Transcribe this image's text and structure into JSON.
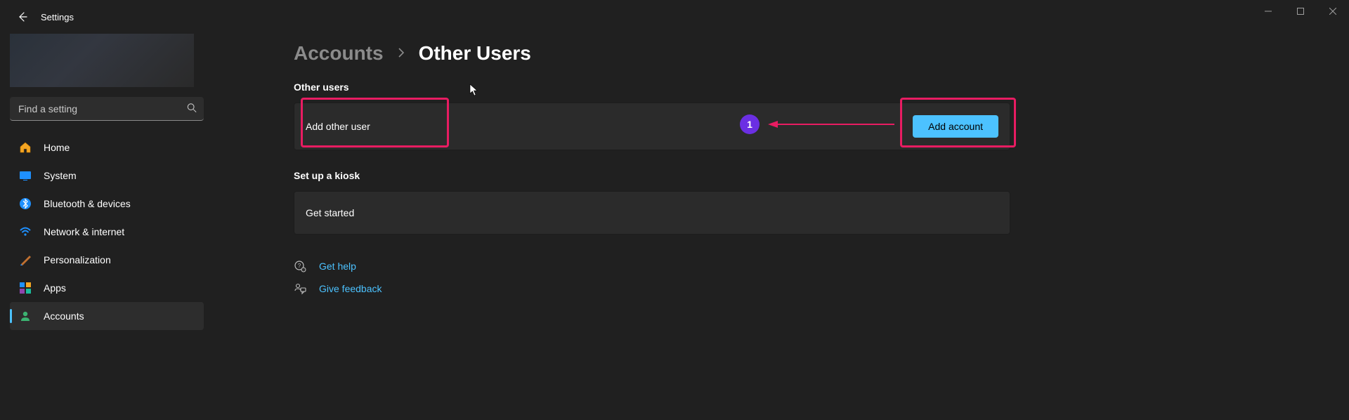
{
  "window": {
    "title": "Settings"
  },
  "search": {
    "placeholder": "Find a setting"
  },
  "sidebar": {
    "items": [
      {
        "label": "Home",
        "icon": "home",
        "active": false
      },
      {
        "label": "System",
        "icon": "display",
        "active": false
      },
      {
        "label": "Bluetooth & devices",
        "icon": "bluetooth",
        "active": false
      },
      {
        "label": "Network & internet",
        "icon": "wifi",
        "active": false
      },
      {
        "label": "Personalization",
        "icon": "brush",
        "active": false
      },
      {
        "label": "Apps",
        "icon": "apps",
        "active": false
      },
      {
        "label": "Accounts",
        "icon": "person",
        "active": true
      }
    ]
  },
  "breadcrumb": {
    "parent": "Accounts",
    "current": "Other Users"
  },
  "sections": {
    "other_users": {
      "heading": "Other users",
      "row_label": "Add other user",
      "button": "Add account"
    },
    "kiosk": {
      "heading": "Set up a kiosk",
      "row_label": "Get started"
    }
  },
  "footer": {
    "help": "Get help",
    "feedback": "Give feedback"
  },
  "annotations": {
    "badge1": "1"
  }
}
